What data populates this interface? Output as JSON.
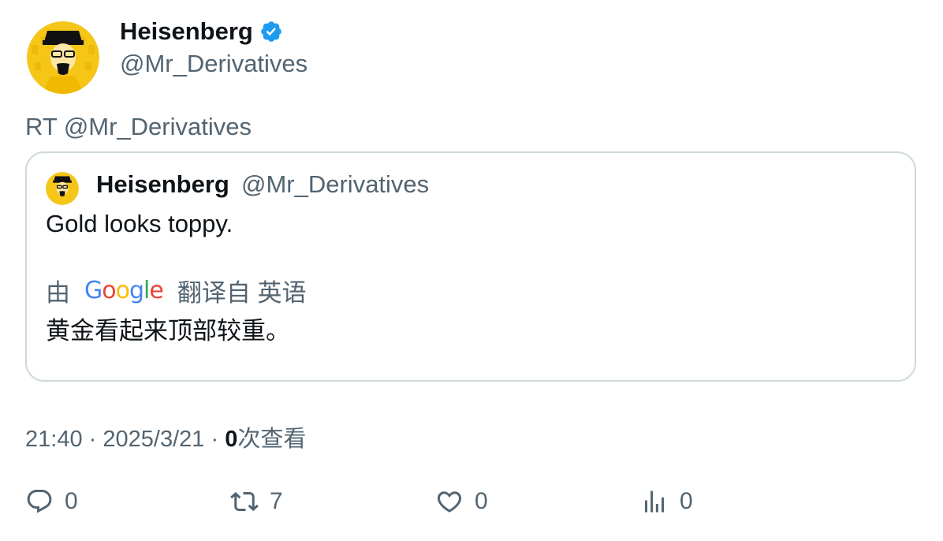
{
  "tweet": {
    "author_name": "Heisenberg",
    "author_handle": "@Mr_Derivatives",
    "retweet_line": "RT @Mr_Derivatives"
  },
  "quoted": {
    "author_name": "Heisenberg",
    "author_handle": "@Mr_Derivatives",
    "text": "Gold looks toppy.",
    "translate_prefix": "由",
    "translate_brand": "Google",
    "translate_suffix": "翻译自 英语",
    "translated_text": "黄金看起来顶部较重。"
  },
  "meta": {
    "time": "21:40",
    "separator": "·",
    "date": "2025/3/21",
    "views_count": "0",
    "views_label": "次查看"
  },
  "actions": {
    "reply_count": "0",
    "retweet_count": "7",
    "like_count": "0",
    "views_count": "0"
  },
  "colors": {
    "verified": "#1d9bf0",
    "secondary_text": "#536471",
    "primary_text": "#0f1419",
    "border": "#cfd9de",
    "avatar_bg": "#f5c518"
  },
  "icons": {
    "verified": "verified-badge-icon",
    "reply": "reply-icon",
    "retweet": "retweet-icon",
    "like": "heart-icon",
    "views": "analytics-icon"
  }
}
